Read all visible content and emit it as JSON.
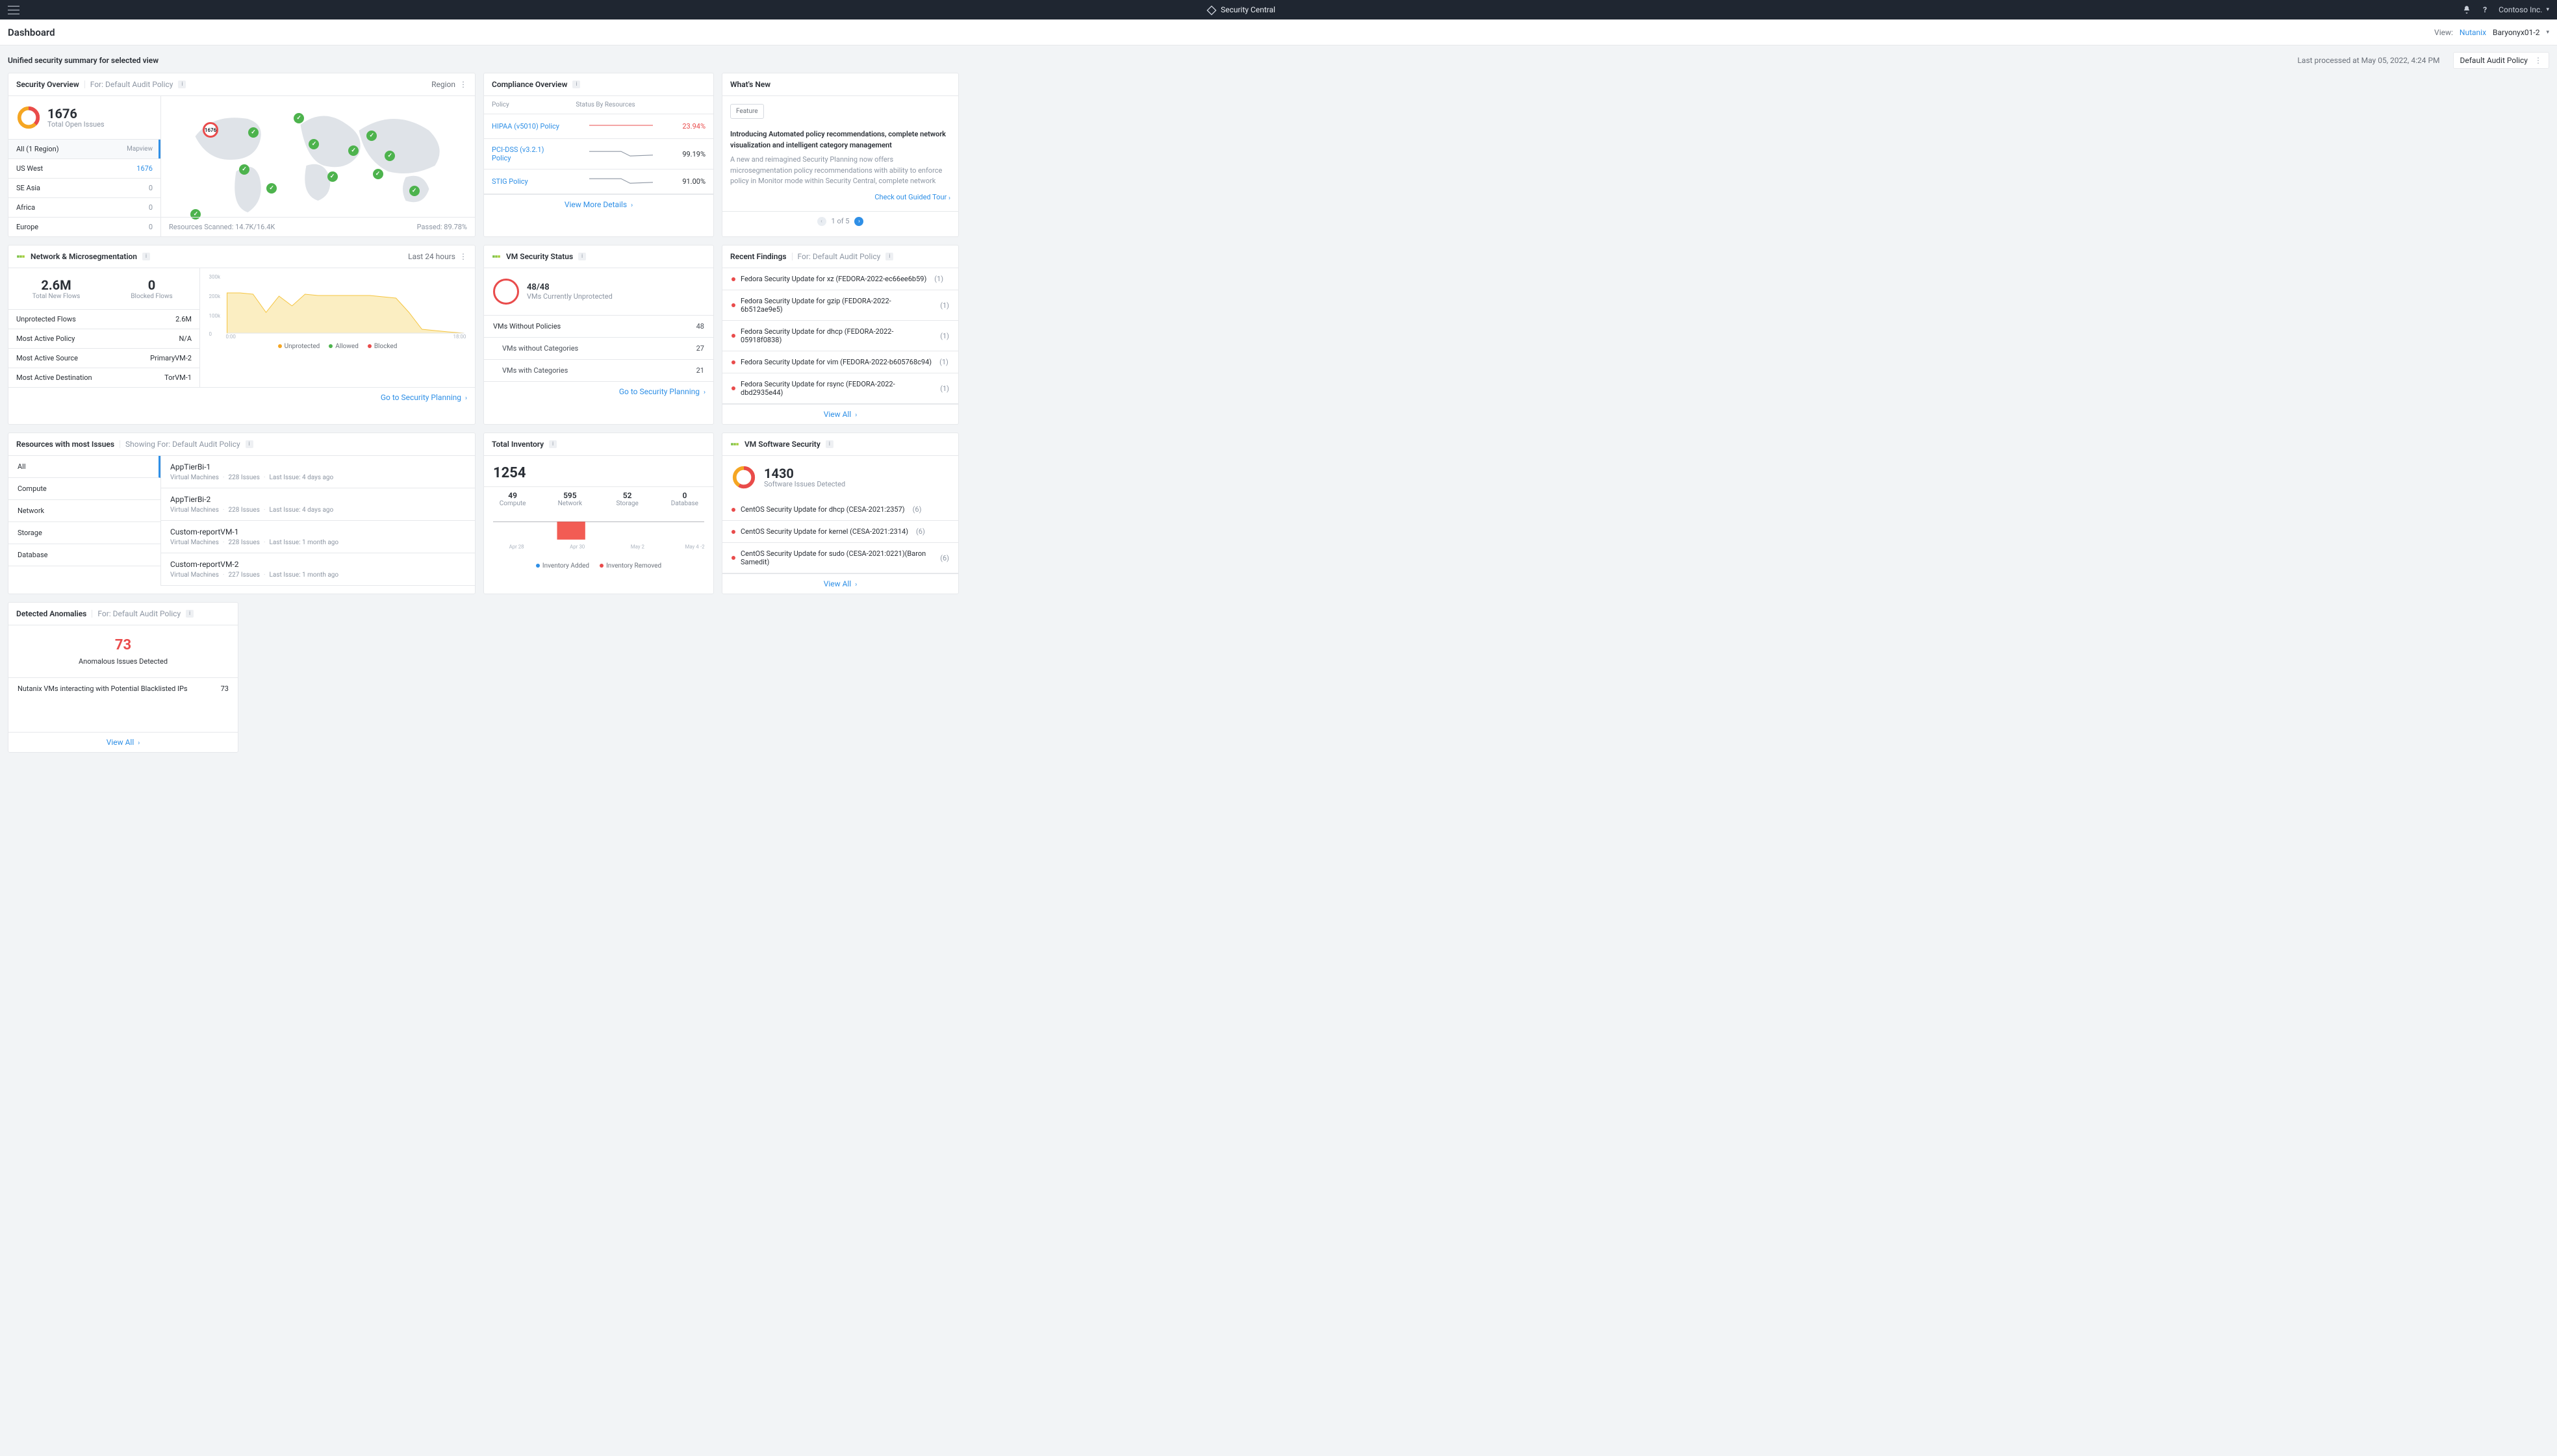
{
  "topbar": {
    "app_name": "Security Central",
    "tenant": "Contoso Inc."
  },
  "subheader": {
    "title": "Dashboard",
    "view_label": "View:",
    "view_primary": "Nutanix",
    "view_secondary": "Baryonyx01-2"
  },
  "toolbar": {
    "summary_label": "Unified security summary for selected view",
    "timestamp": "Last processed at May 05, 2022, 4:24 PM",
    "policy_select": "Default Audit Policy"
  },
  "security_overview": {
    "title": "Security Overview",
    "for_label": "For: Default Audit Policy",
    "region_label": "Region",
    "total_issues_value": "1676",
    "total_issues_label": "Total Open Issues",
    "all_label": "All (1 Region)",
    "mapview_label": "Mapview",
    "regions": [
      {
        "name": "US West",
        "count": "1676",
        "cls": "blue"
      },
      {
        "name": "SE Asia",
        "count": "0",
        "cls": ""
      },
      {
        "name": "Africa",
        "count": "0",
        "cls": ""
      },
      {
        "name": "Europe",
        "count": "0",
        "cls": ""
      }
    ],
    "scanned_label": "Resources Scanned: 14.7K/16.4K",
    "passed_label": "Passed: 89.78%",
    "map_ring_label": "1676"
  },
  "compliance": {
    "title": "Compliance Overview",
    "col_policy": "Policy",
    "col_status": "Status By Resources",
    "rows": [
      {
        "name": "HIPAA (v5010) Policy",
        "pct": "23.94%",
        "red": true
      },
      {
        "name": "PCI-DSS (v3.2.1) Policy",
        "pct": "99.19%",
        "red": false
      },
      {
        "name": "STIG Policy",
        "pct": "91.00%",
        "red": false
      }
    ],
    "more": "View More Details"
  },
  "whats_new": {
    "title": "What's New",
    "badge": "Feature",
    "headline": "Introducing Automated policy recommendations, complete network visualization and intelligent category management",
    "desc": "A new and reimagined Security Planning now offers microsegmentation policy recommendations with ability to enforce policy in Monitor mode within Security Central, complete network visualisation with visibility of one-hop connections and intelligent category suggestions with ability",
    "tour": "Check out Guided Tour",
    "pager": "1 of 5"
  },
  "network": {
    "title": "Network & Microsegmentation",
    "range": "Last 24 hours",
    "new_flows_value": "2.6M",
    "new_flows_label": "Total New Flows",
    "blocked_value": "0",
    "blocked_label": "Blocked Flows",
    "rows": [
      {
        "k": "Unprotected Flows",
        "v": "2.6M"
      },
      {
        "k": "Most Active Policy",
        "v": "N/A"
      },
      {
        "k": "Most Active Source",
        "v": "PrimaryVM-2"
      },
      {
        "k": "Most Active Destination",
        "v": "TorVM-1"
      }
    ],
    "legend": {
      "unprotected": "Unprotected",
      "allowed": "Allowed",
      "blocked": "Blocked"
    },
    "link": "Go to Security Planning",
    "chart_data": {
      "type": "area",
      "ylim": [
        0,
        300000
      ],
      "yticks": [
        "0",
        "100k",
        "200k",
        "300k"
      ],
      "xticks": [
        "0:00",
        "18:00"
      ],
      "series": [
        {
          "name": "Unprotected",
          "values": [
            210000,
            210000,
            200000,
            110000,
            195000,
            150000,
            200000,
            195000,
            195000,
            195000,
            195000,
            195000,
            195000,
            195000,
            190000,
            185000,
            120000,
            30000,
            20000,
            18000,
            15000,
            10000,
            8000,
            5000
          ]
        }
      ]
    }
  },
  "vm_security": {
    "title": "VM Security Status",
    "ratio": "48/48",
    "ratio_label": "VMs Currently Unprotected",
    "rows": [
      {
        "k": "VMs Without Policies",
        "v": "48",
        "indent": false
      },
      {
        "k": "VMs without Categories",
        "v": "27",
        "indent": true
      },
      {
        "k": "VMs with Categories",
        "v": "21",
        "indent": true
      }
    ],
    "link": "Go to Security Planning"
  },
  "recent_findings": {
    "title": "Recent Findings",
    "for_label": "For: Default Audit Policy",
    "items": [
      {
        "name": "Fedora Security Update for xz (FEDORA-2022-ec66ee6b59)",
        "count": "(1)"
      },
      {
        "name": "Fedora Security Update for gzip (FEDORA-2022-6b512ae9e5)",
        "count": "(1)"
      },
      {
        "name": "Fedora Security Update for dhcp (FEDORA-2022-05918f0838)",
        "count": "(1)"
      },
      {
        "name": "Fedora Security Update for vim (FEDORA-2022-b605768c94)",
        "count": "(1)"
      },
      {
        "name": "Fedora Security Update for rsync (FEDORA-2022-dbd2935e44)",
        "count": "(1)"
      }
    ],
    "link": "View All"
  },
  "resources": {
    "title": "Resources with most Issues",
    "for_label": "Showing For: Default Audit Policy",
    "tabs": [
      "All",
      "Compute",
      "Network",
      "Storage",
      "Database"
    ],
    "items": [
      {
        "name": "AppTierBi-1",
        "type": "Virtual Machines",
        "issues": "228 Issues",
        "last": "Last Issue: 4 days ago"
      },
      {
        "name": "AppTierBi-2",
        "type": "Virtual Machines",
        "issues": "228 Issues",
        "last": "Last Issue: 4 days ago"
      },
      {
        "name": "Custom-reportVM-1",
        "type": "Virtual Machines",
        "issues": "228 Issues",
        "last": "Last Issue: 1 month ago"
      },
      {
        "name": "Custom-reportVM-2",
        "type": "Virtual Machines",
        "issues": "227 Issues",
        "last": "Last Issue: 1 month ago"
      }
    ]
  },
  "inventory": {
    "title": "Total Inventory",
    "total": "1254",
    "cols": [
      {
        "n": "49",
        "l": "Compute"
      },
      {
        "n": "595",
        "l": "Network"
      },
      {
        "n": "52",
        "l": "Storage"
      },
      {
        "n": "0",
        "l": "Database"
      }
    ],
    "legend": {
      "added": "Inventory Added",
      "removed": "Inventory Removed"
    },
    "xaxis": [
      "Apr 28",
      "Apr 30",
      "May 2",
      "May 4"
    ],
    "yright": "-2",
    "chart_data": {
      "type": "bar",
      "x": [
        "Apr 28",
        "Apr 29",
        "Apr 30",
        "May 1",
        "May 2",
        "May 3",
        "May 4"
      ],
      "series": [
        {
          "name": "Inventory Added",
          "values": [
            0,
            0,
            0,
            0,
            0,
            0,
            0
          ]
        },
        {
          "name": "Inventory Removed",
          "values": [
            0,
            0,
            -2,
            0,
            0,
            0,
            0
          ]
        }
      ]
    }
  },
  "software": {
    "title": "VM Software Security",
    "value": "1430",
    "label": "Software Issues Detected",
    "items": [
      {
        "name": "CentOS Security Update for dhcp (CESA-2021:2357)",
        "count": "(6)"
      },
      {
        "name": "CentOS Security Update for kernel (CESA-2021:2314)",
        "count": "(6)"
      },
      {
        "name": "CentOS Security Update for sudo (CESA-2021:0221)(Baron Samedit)",
        "count": "(6)"
      }
    ],
    "link": "View All"
  },
  "anomalies": {
    "title": "Detected Anomalies",
    "for_label": "For: Default Audit Policy",
    "value": "73",
    "label": "Anomalous Issues Detected",
    "row_k": "Nutanix VMs interacting with Potential Blacklisted IPs",
    "row_v": "73",
    "link": "View All"
  }
}
